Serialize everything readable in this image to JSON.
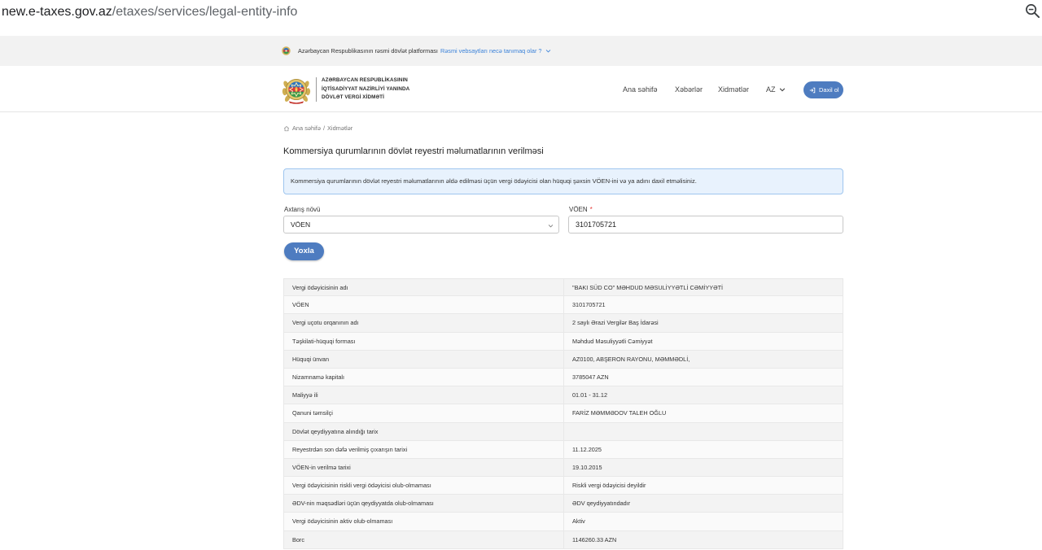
{
  "browser": {
    "url_host": "new.e-taxes.gov.az",
    "url_path": "/etaxes/services/legal-entity-info",
    "zoom_icon": "zoom-out-icon"
  },
  "banner": {
    "icon": "emblem-icon",
    "text": "Azərbaycan Respublikasının rəsmi dövlət platforması",
    "link": "Rəsmi vebsaytları necə tanımaq olar ?",
    "link_icon": "chevron-down-icon"
  },
  "header": {
    "logo_icon": "state-emblem-icon",
    "org_lines": [
      "AZƏRBAYCAN RESPUBLİKASININ",
      "İQTİSADİYYAT NAZİRLİYİ YANINDA",
      "DÖVLƏT VERGİ XİDMƏTİ"
    ],
    "nav": [
      {
        "label": "Ana səhifə"
      },
      {
        "label": "Xəbərlər"
      },
      {
        "label": "Xidmətlər"
      }
    ],
    "language": "AZ",
    "login": "Daxil ol",
    "login_icon": "login-icon"
  },
  "breadcrumb": {
    "home_icon": "home-icon",
    "home": "Ana səhifə",
    "separator": "/",
    "current": "Xidmətlər"
  },
  "page": {
    "title": "Kommersiya qurumlarının dövlət reyestri məlumatlarının verilməsi",
    "info": "Kommersiya qurumlarının dövlət reyestri məlumatlarının əldə edilməsi üçün vergi ödəyicisi olan hüquqi şəxsin VÖEN-ini və ya adını daxil etməlisiniz."
  },
  "form": {
    "search_type_label": "Axtarış növü",
    "search_type_value": "VÖEN",
    "voen_label": "VÖEN",
    "required_mark": "*",
    "voen_value": "3101705721",
    "submit": "Yoxla"
  },
  "results": [
    {
      "label": "Vergi ödəyicisinin adı",
      "value": "\"BAKI SÜD CO\" MƏHDUD MƏSULİYYƏTLİ CƏMİYYƏTİ"
    },
    {
      "label": "VÖEN",
      "value": "3101705721"
    },
    {
      "label": "Vergi uçotu orqanının adı",
      "value": "2 saylı Ərazi Vergilər Baş İdarəsi"
    },
    {
      "label": "Təşkilati-hüquqi forması",
      "value": "Məhdud Məsuliyyətli Cəmiyyət"
    },
    {
      "label": "Hüquqi ünvan",
      "value": "AZ0100, ABŞERON RAYONU, MƏMMƏDLİ,"
    },
    {
      "label": "Nizamnamə kapitalı",
      "value": "3785047 AZN"
    },
    {
      "label": "Maliyyə ili",
      "value": "01.01 - 31.12"
    },
    {
      "label": "Qanuni təmsilçi",
      "value": "FARİZ MƏMMƏDOV TALEH OĞLU"
    },
    {
      "label": "Dövlət qeydiyyatına alındığı tarix",
      "value": ""
    },
    {
      "label": "Reyestrdən son dəfə verilmiş çıxarışın tarixi",
      "value": "11.12.2025"
    },
    {
      "label": "VÖEN-in verilmə tarixi",
      "value": "19.10.2015"
    },
    {
      "label": "Vergi ödəyicisinin riskli vergi ödəyicisi olub-olmaması",
      "value": "Riskli vergi ödəyicisi deyildir"
    },
    {
      "label": "ƏDV-nin məqsədləri üçün qeydiyyatda olub-olmaması",
      "value": "ƏDV qeydiyyatındadır"
    },
    {
      "label": "Vergi ödəyicisinin aktiv olub-olmaması",
      "value": "Aktiv"
    },
    {
      "label": "Borc",
      "value": "1146260.33 AZN"
    }
  ],
  "colors": {
    "accent": "#4e7cc0",
    "link": "#3b82d9",
    "info_bg": "#e8f2fd",
    "info_border": "#9fc6ef",
    "required": "#e53935"
  }
}
